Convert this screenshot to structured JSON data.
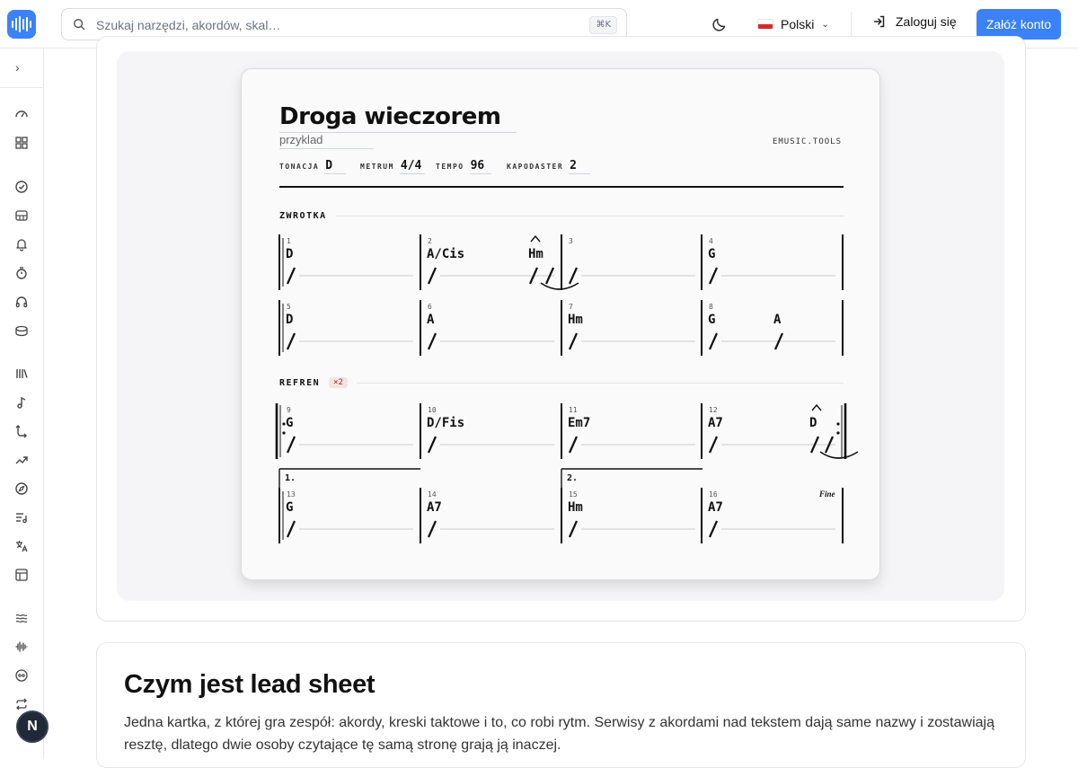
{
  "search": {
    "placeholder": "Szukaj narzędzi, akordów, skal…",
    "shortcut": "⌘K"
  },
  "header": {
    "language": "Polski",
    "login_label": "Zaloguj się",
    "signup_label": "Załóż konto",
    "accent": "#3b82f6"
  },
  "sidebar": {
    "avatar_letter": "N"
  },
  "sheet": {
    "title": "Droga wieczorem",
    "subtitle": "przyklad",
    "brand": "EMUSIC.TOOLS",
    "meta": [
      {
        "key": "TONACJA",
        "value": "D"
      },
      {
        "key": "METRUM",
        "value": "4/4"
      },
      {
        "key": "TEMPO",
        "value": "96"
      },
      {
        "key": "KAPODASTER",
        "value": "2"
      }
    ],
    "sections": [
      {
        "label": "ZWROTKA"
      },
      {
        "label": "REFREN",
        "repeat": "×2"
      }
    ]
  },
  "chart_data": {
    "type": "table",
    "rows": [
      {
        "section": "ZWROTKA",
        "bars": [
          {
            "num": "1",
            "chords": [
              "D"
            ]
          },
          {
            "num": "2",
            "chords": [
              "A/Cis",
              "Hm"
            ],
            "fermata_on": "Hm",
            "tie": true
          },
          {
            "num": "3",
            "chords": []
          },
          {
            "num": "4",
            "chords": [
              "G"
            ]
          }
        ]
      },
      {
        "section": "ZWROTKA",
        "bars": [
          {
            "num": "5",
            "chords": [
              "D"
            ]
          },
          {
            "num": "6",
            "chords": [
              "A"
            ]
          },
          {
            "num": "7",
            "chords": [
              "Hm"
            ]
          },
          {
            "num": "8",
            "chords": [
              "G",
              "A"
            ]
          }
        ]
      },
      {
        "section": "REFREN",
        "bars": [
          {
            "num": "9",
            "chords": [
              "G"
            ],
            "repeat_start": true
          },
          {
            "num": "10",
            "chords": [
              "D/Fis"
            ]
          },
          {
            "num": "11",
            "chords": [
              "Em7"
            ]
          },
          {
            "num": "12",
            "chords": [
              "A7",
              "D"
            ],
            "fermata_on": "D",
            "tie": true,
            "repeat_end": true
          }
        ]
      },
      {
        "section": "REFREN",
        "bars": [
          {
            "num": "13",
            "chords": [
              "G"
            ],
            "ending": "1."
          },
          {
            "num": "14",
            "chords": [
              "A7"
            ]
          },
          {
            "num": "15",
            "chords": [
              "Hm"
            ],
            "ending": "2."
          },
          {
            "num": "16",
            "chords": [
              "A7"
            ],
            "marking": "Fine"
          }
        ]
      }
    ]
  },
  "info": {
    "heading": "Czym jest lead sheet",
    "text": "Jedna kartka, z której gra zespół: akordy, kreski taktowe i to, co robi rytm. Serwisy z akordami nad tekstem dają same nazwy i zostawiają resztę, dlatego dwie osoby czytające tę samą stronę grają ją inaczej."
  }
}
